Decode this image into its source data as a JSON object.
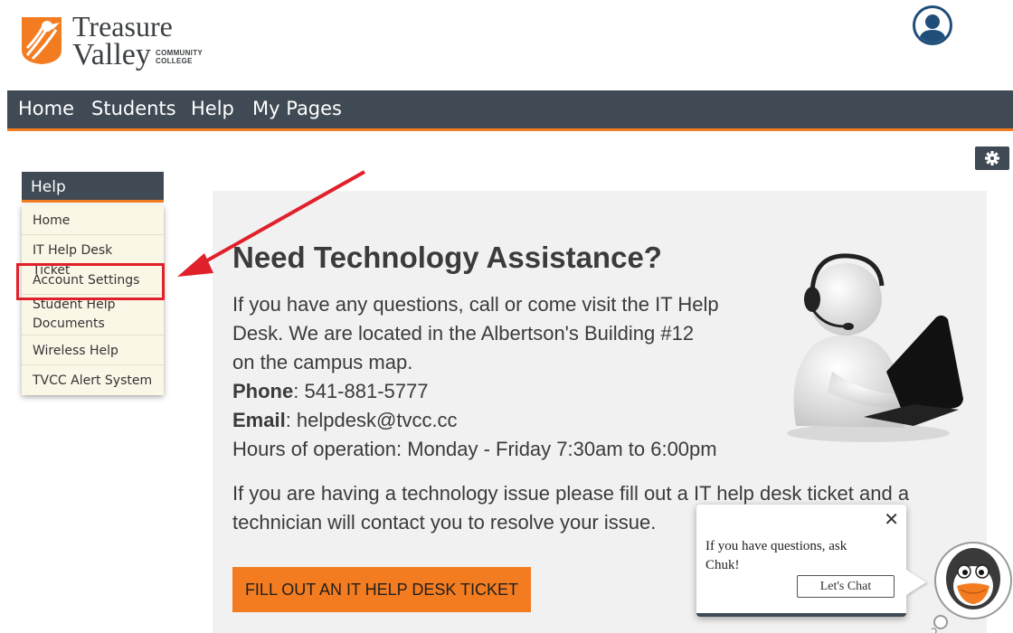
{
  "logo": {
    "line1": "Treasure",
    "line2": "Valley",
    "line3a": "COMMUNITY",
    "line3b": "COLLEGE",
    "brand_color": "#f47c20",
    "text_color": "#3c4043"
  },
  "header": {
    "user_icon": "user-icon",
    "user_icon_color": "#1f4e79"
  },
  "nav": {
    "items": [
      {
        "label": "Home"
      },
      {
        "label": "Students"
      },
      {
        "label": "Help"
      },
      {
        "label": "My Pages"
      }
    ],
    "bg_color": "#3f4a55",
    "accent_color": "#f47c20"
  },
  "settings": {
    "icon": "gear-icon"
  },
  "sidebar": {
    "title": "Help",
    "items": [
      {
        "label": "Home"
      },
      {
        "label": "IT Help Desk Ticket"
      },
      {
        "label": "Account Settings",
        "highlighted": true
      },
      {
        "label_line1": "Student Help",
        "label_line2": "Documents"
      },
      {
        "label": "Wireless Help"
      },
      {
        "label": "TVCC Alert System"
      }
    ],
    "highlight_color": "#e0202a"
  },
  "main": {
    "title": "Need Technology Assistance?",
    "intro_line1": "If you have any questions, call or come visit the IT Help",
    "intro_line2": "Desk. We are located in the Albertson's Building #12",
    "intro_line3": "on the campus map.",
    "phone_label": "Phone",
    "phone_value": ": 541-881-5777",
    "email_label": "Email",
    "email_value": ":  helpdesk@tvcc.cc",
    "hours": "Hours of operation: Monday - Friday 7:30am to 6:00pm",
    "issue_line1": "If you are having a technology issue please fill out a IT help desk ticket and a",
    "issue_line2": "technician will contact you to resolve your issue.",
    "ticket_button": "FILL OUT AN IT HELP DESK TICKET",
    "illustration": "headset-technician-laptop-image"
  },
  "chat": {
    "close_glyph": "✕",
    "message_line1": "If you have questions, ask",
    "message_line2": "Chuk!",
    "button": "Let's Chat",
    "mascot": "penguin-mascot-icon"
  }
}
